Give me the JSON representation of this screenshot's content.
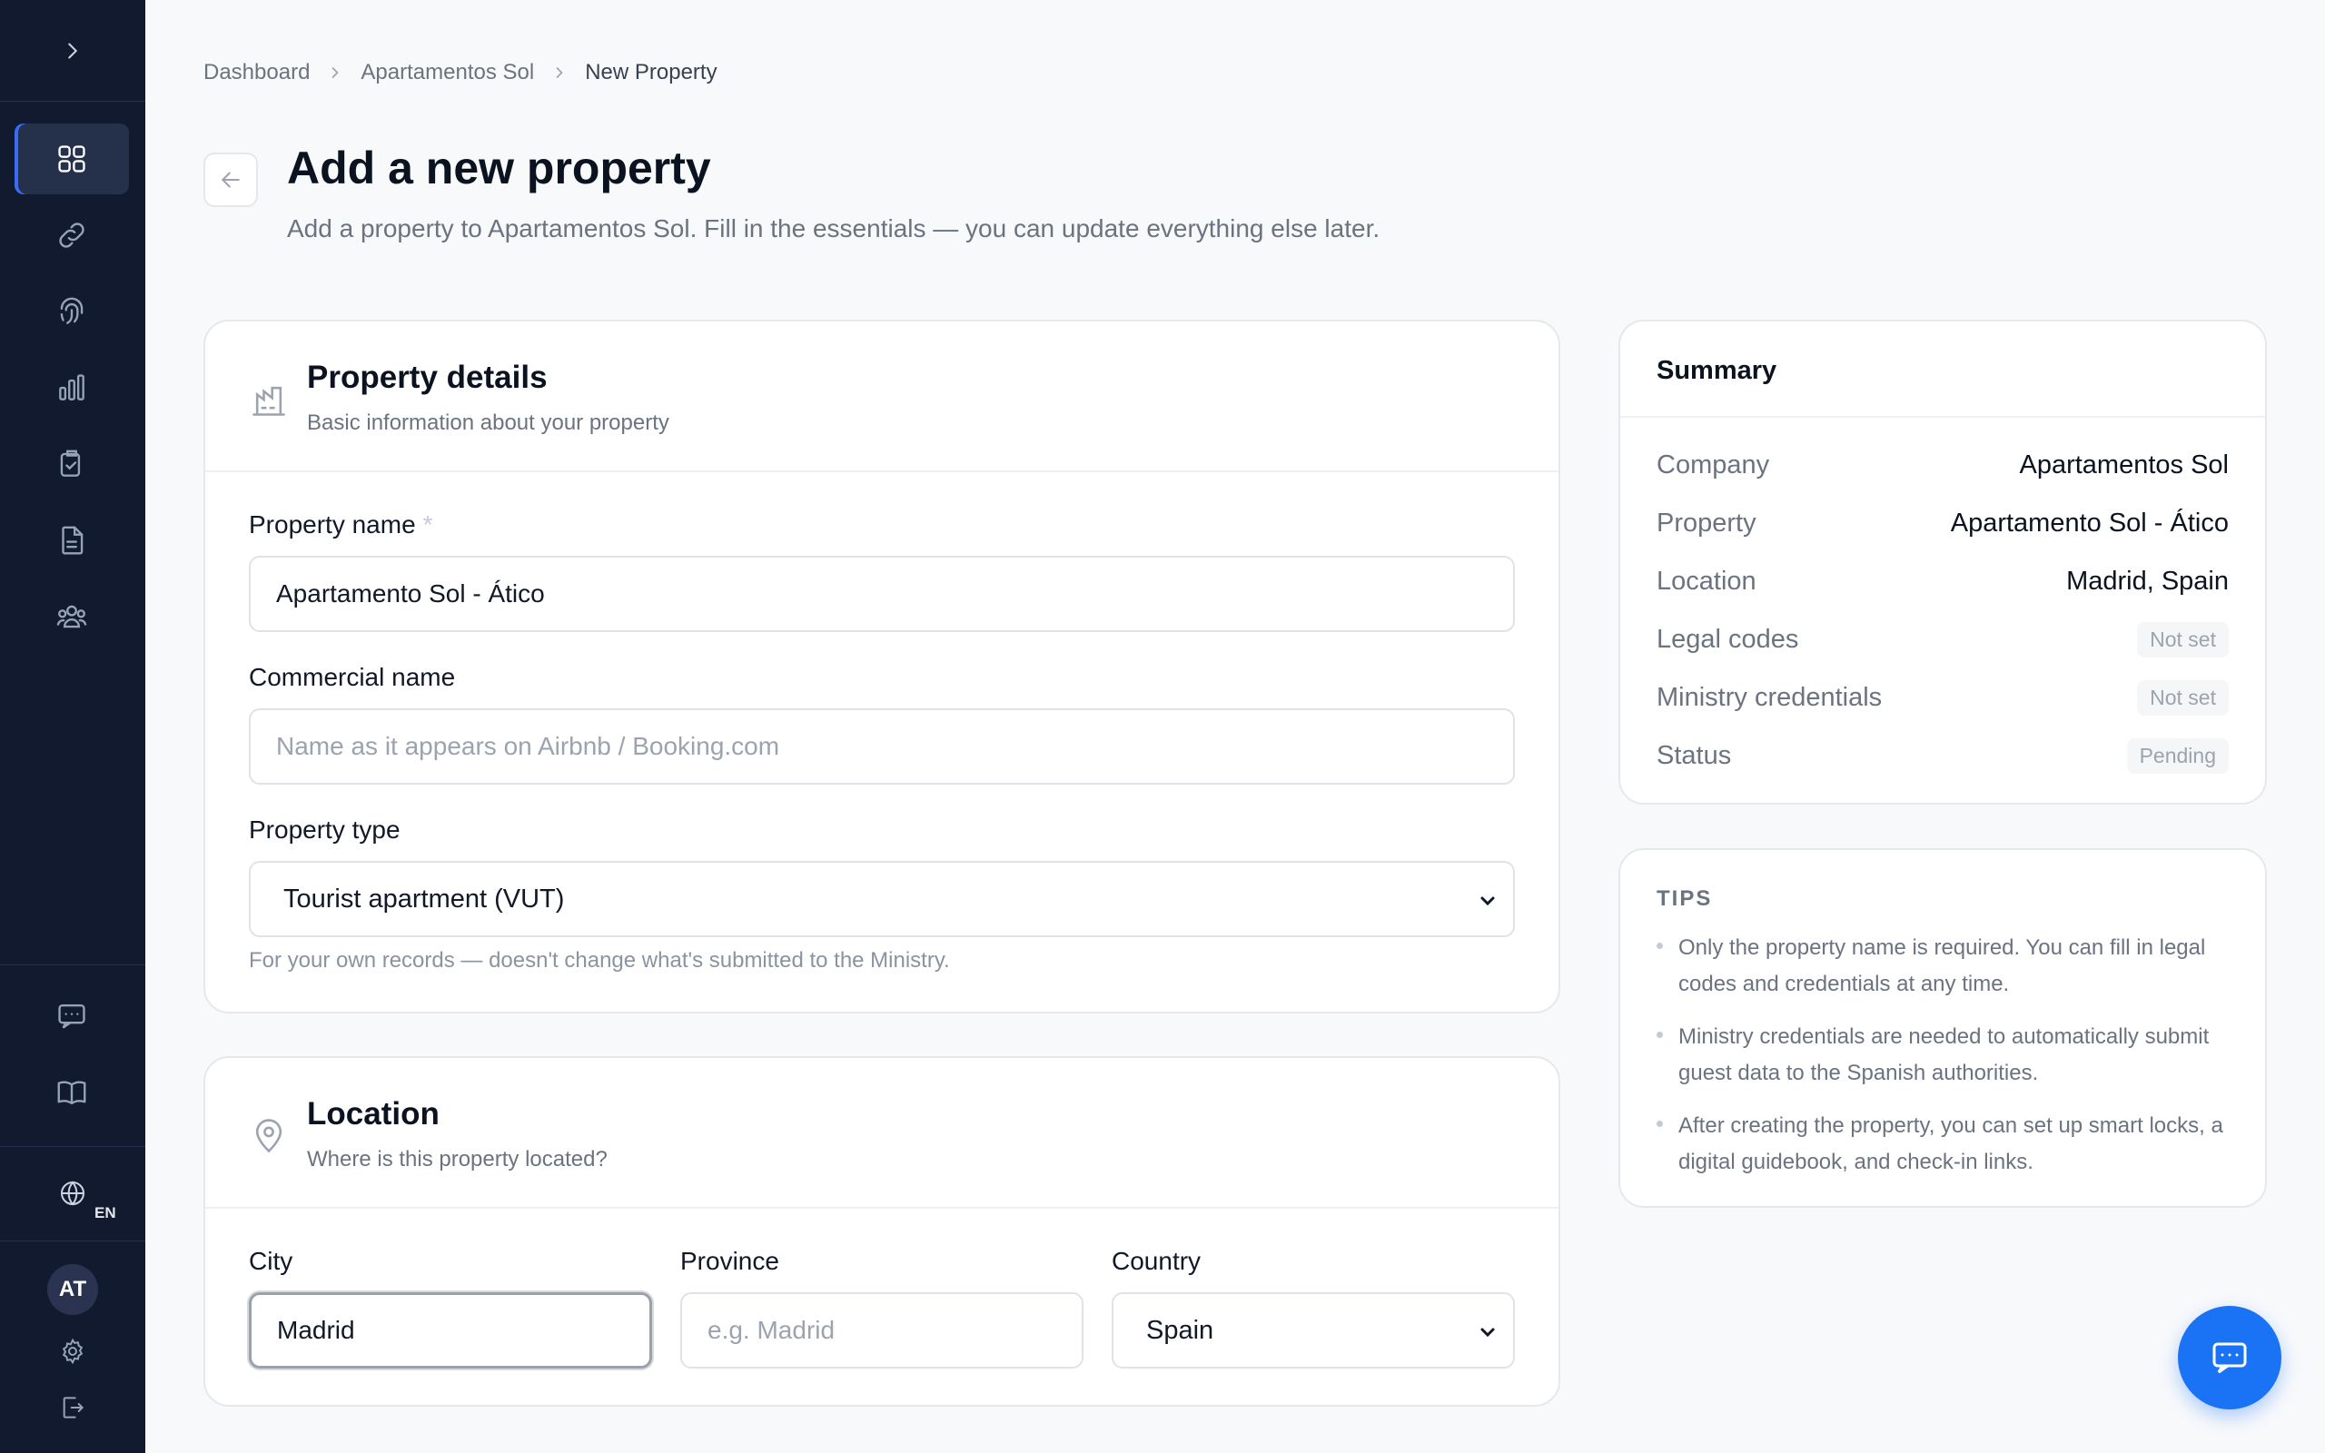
{
  "sidebar": {
    "lang": "EN",
    "avatar_initials": "AT",
    "icons": [
      "grid-icon",
      "link-icon",
      "fingerprint-icon",
      "bar-chart-icon",
      "clipboard-check-icon",
      "document-icon",
      "users-icon",
      "chat-icon",
      "book-icon",
      "globe-icon",
      "settings-icon",
      "logout-icon"
    ]
  },
  "breadcrumb": {
    "items": [
      "Dashboard",
      "Apartamentos Sol",
      "New Property"
    ]
  },
  "header": {
    "title": "Add a new property",
    "subtitle": "Add a property to Apartamentos Sol. Fill in the essentials — you can update everything else later."
  },
  "details": {
    "title": "Property details",
    "subtitle": "Basic information about your property",
    "name_label": "Property name",
    "name_required": "*",
    "name_value": "Apartamento Sol - Ático",
    "commercial_label": "Commercial name",
    "commercial_placeholder": "Name as it appears on Airbnb / Booking.com",
    "type_label": "Property type",
    "type_value": "Tourist apartment (VUT)",
    "type_hint": "For your own records — doesn't change what's submitted to the Ministry."
  },
  "location": {
    "title": "Location",
    "subtitle": "Where is this property located?",
    "city_label": "City",
    "city_value": "Madrid",
    "province_label": "Province",
    "province_placeholder": "e.g. Madrid",
    "country_label": "Country",
    "country_value": "Spain"
  },
  "summary": {
    "title": "Summary",
    "rows": [
      {
        "key": "Company",
        "value": "Apartamentos Sol"
      },
      {
        "key": "Property",
        "value": "Apartamento Sol - Ático"
      },
      {
        "key": "Location",
        "value": "Madrid, Spain"
      },
      {
        "key": "Legal codes",
        "value": "Not set"
      },
      {
        "key": "Ministry credentials",
        "value": "Not set"
      },
      {
        "key": "Status",
        "value": "Pending"
      }
    ]
  },
  "tips": {
    "title": "TIPS",
    "items": [
      "Only the property name is required. You can fill in legal codes and credentials at any time.",
      "Ministry credentials are needed to automatically submit guest data to the Spanish authorities.",
      "After creating the property, you can set up smart locks, a digital guidebook, and check-in links."
    ]
  },
  "colors": {
    "sidebar_bg": "#121a2f",
    "accent": "#1a73f5",
    "page_bg": "#f8f9fb"
  }
}
